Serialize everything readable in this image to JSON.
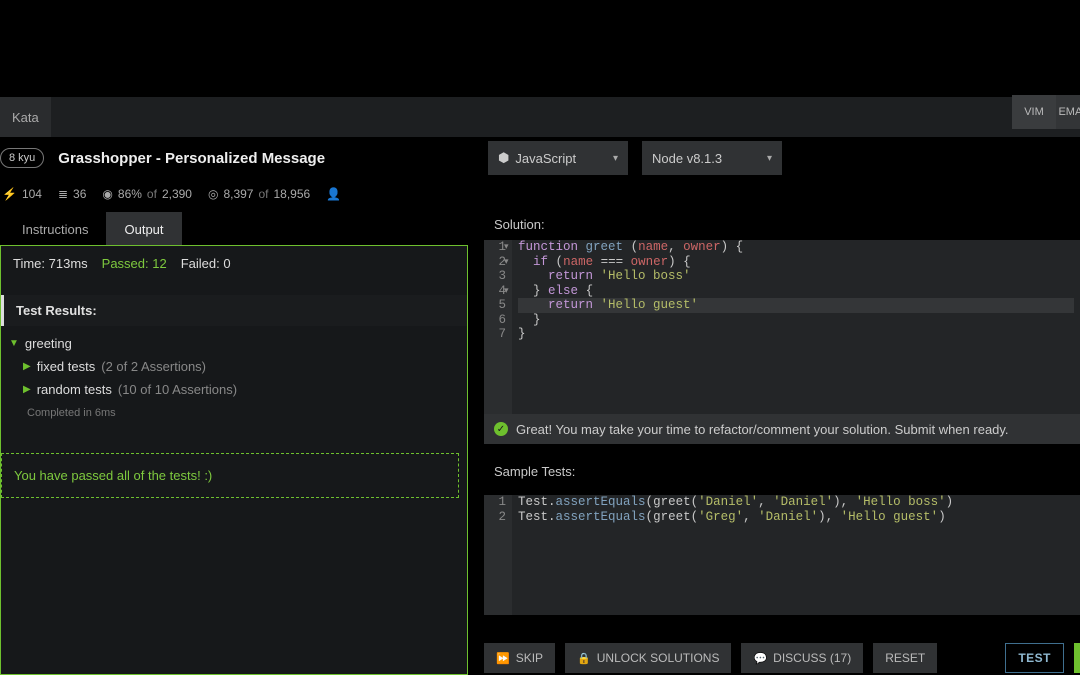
{
  "breadcrumb": "Kata",
  "kyu_label": "8 kyu",
  "kata_title": "Grasshopper - Personalized Message",
  "stats": {
    "points": "104",
    "collections": "36",
    "satisfaction_pct": "86%",
    "satisfaction_of": "of",
    "satisfaction_total": "2,390",
    "completed": "8,397",
    "completed_of": "of",
    "completed_total": "18,956"
  },
  "tabs": {
    "instructions": "Instructions",
    "output": "Output"
  },
  "status": {
    "time_label": "Time: 713ms",
    "passed_label": "Passed: 12",
    "failed_label": "Failed: 0"
  },
  "results_header": "Test Results:",
  "tree": {
    "suite": "greeting",
    "fixed_label": "fixed tests",
    "fixed_assert": "(2 of 2 Assertions)",
    "random_label": "random tests",
    "random_assert": "(10 of 10 Assertions)",
    "completed": "Completed in 6ms"
  },
  "passed_all": "You have passed all of the tests! :)",
  "lang_dropdown": "JavaScript",
  "runtime_dropdown": "Node v8.1.3",
  "modes": {
    "vim": "VIM",
    "emacs": "EMACS"
  },
  "solution_label": "Solution:",
  "solution_code": {
    "l1a": "function",
    "l1b": "greet",
    "l1c": "name",
    "l1d": "owner",
    "l2a": "if",
    "l2b": "name",
    "l2c": "owner",
    "l3a": "return",
    "l3b": "'Hello boss'",
    "l4a": "else",
    "l5a": "return",
    "l5b": "'Hello guest'"
  },
  "success_msg": "Great! You may take your time to refactor/comment your solution. Submit when ready.",
  "sample_label": "Sample Tests:",
  "sample_code": {
    "obj": "Test",
    "met": "assertEquals",
    "greet": "greet",
    "a1": "'Daniel'",
    "a2": "'Daniel'",
    "a3": "'Hello boss'",
    "b1": "'Greg'",
    "b2": "'Daniel'",
    "b3": "'Hello guest'"
  },
  "buttons": {
    "skip": "SKIP",
    "unlock": "UNLOCK SOLUTIONS",
    "discuss": "DISCUSS (17)",
    "reset": "RESET",
    "test": "TEST"
  }
}
